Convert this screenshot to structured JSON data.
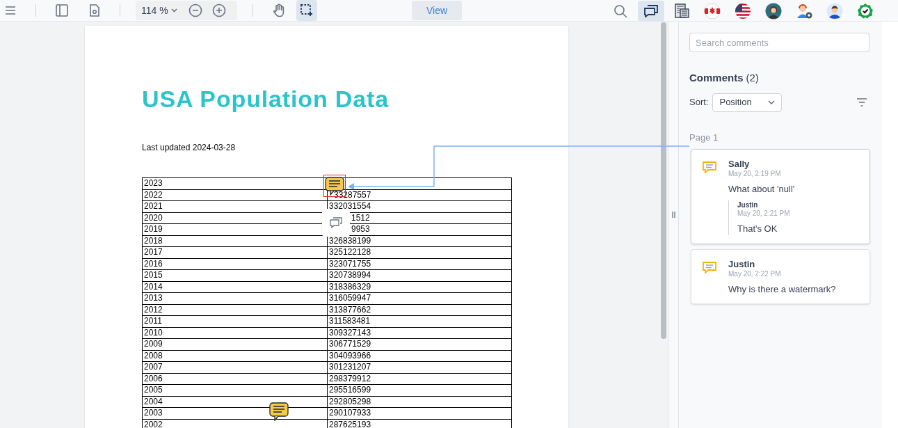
{
  "toolbar": {
    "zoom": "114 %",
    "view_button": "View",
    "tools": [
      {
        "kind": "pan",
        "selected": false
      },
      {
        "kind": "area_select",
        "selected": true
      }
    ],
    "right_tools": [
      {
        "kind": "search",
        "selected": false
      },
      {
        "kind": "comments",
        "selected": true
      },
      {
        "kind": "newspaper",
        "selected": false
      },
      {
        "kind": "canada",
        "selected": false
      },
      {
        "kind": "usa",
        "selected": false
      },
      {
        "kind": "woman",
        "selected": false
      },
      {
        "kind": "support",
        "selected": false
      },
      {
        "kind": "man",
        "selected": false
      },
      {
        "kind": "check",
        "selected": false
      }
    ]
  },
  "document": {
    "title": "USA Population Data",
    "subtitle": "Last updated 2024-03-28",
    "rows": [
      {
        "year": "2023"
      },
      {
        "year": "2022",
        "value": "33287557",
        "covered": true
      },
      {
        "year": "2021",
        "value": "332031554",
        "covered": false
      },
      {
        "year": "2020",
        "value": "1512",
        "covered": true
      },
      {
        "year": "2019",
        "value": "9953",
        "covered": true
      },
      {
        "year": "2018",
        "value": "326838199",
        "covered": false
      },
      {
        "year": "2017",
        "value": "325122128",
        "covered": false
      },
      {
        "year": "2016",
        "value": "323071755",
        "covered": false
      },
      {
        "year": "2015",
        "value": "320738994",
        "covered": false
      },
      {
        "year": "2014",
        "value": "318386329",
        "covered": false
      },
      {
        "year": "2013",
        "value": "316059947",
        "covered": false
      },
      {
        "year": "2012",
        "value": "313877662",
        "covered": false
      },
      {
        "year": "2011",
        "value": "311583481",
        "covered": false
      },
      {
        "year": "2010",
        "value": "309327143",
        "covered": false
      },
      {
        "year": "2009",
        "value": "306771529",
        "covered": false
      },
      {
        "year": "2008",
        "value": "304093966",
        "covered": false
      },
      {
        "year": "2007",
        "value": "301231207",
        "covered": false
      },
      {
        "year": "2006",
        "value": "298379912",
        "covered": false
      },
      {
        "year": "2005",
        "value": "295516599",
        "covered": false
      },
      {
        "year": "2004",
        "value": "292805298",
        "covered": false
      },
      {
        "year": "2003",
        "value": "290107933",
        "covered": false
      },
      {
        "year": "2002",
        "value": "287625193",
        "covered": false
      }
    ]
  },
  "comments_panel": {
    "search_placeholder": "Search comments",
    "title": "Comments",
    "count": "(2)",
    "sort_label": "Sort:",
    "sort_value": "Position",
    "page_label": "Page 1",
    "comments": [
      {
        "author": "Sally",
        "time": "May 20, 2:19 PM",
        "text": "What about 'null'",
        "selected": true,
        "replies": [
          {
            "author": "Justin",
            "time": "May 20, 2:21 PM",
            "text": "That's OK"
          }
        ]
      },
      {
        "author": "Justin",
        "time": "May 20, 2:22 PM",
        "text": "Why is there a watermark?",
        "selected": false
      }
    ]
  }
}
